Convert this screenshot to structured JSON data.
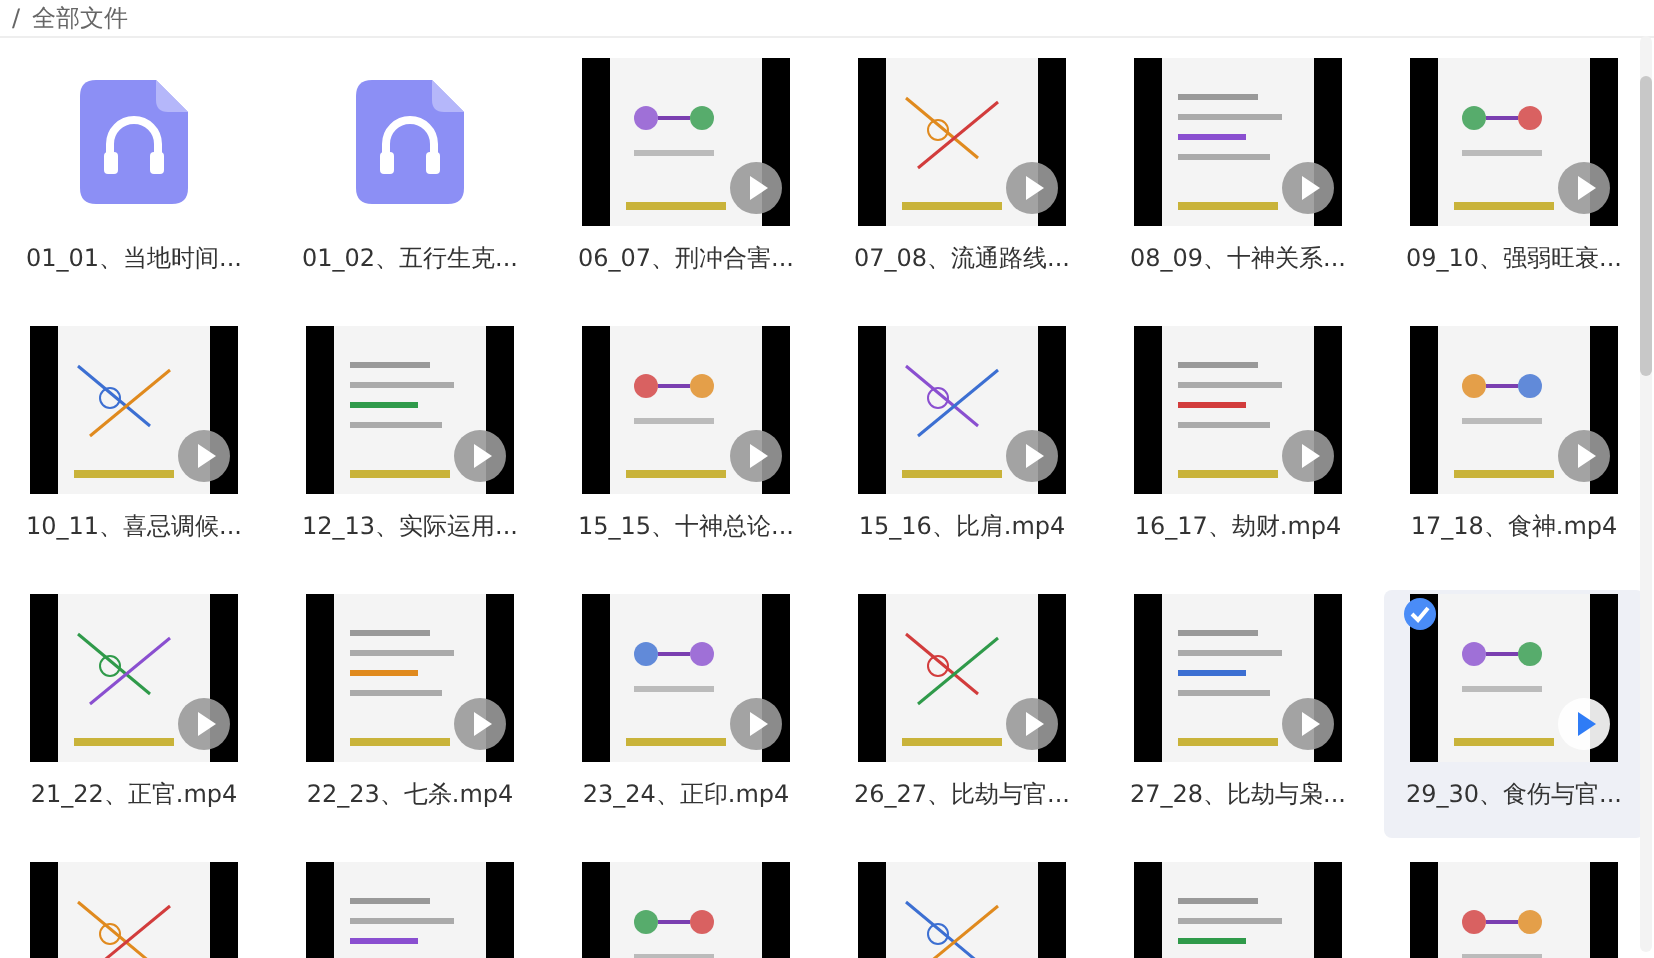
{
  "breadcrumb": {
    "separator": "/",
    "current": "全部文件"
  },
  "files": [
    {
      "kind": "audio",
      "name": "01_01、当地时间...",
      "selected": false
    },
    {
      "kind": "audio",
      "name": "01_02、五行生克...",
      "selected": false
    },
    {
      "kind": "video",
      "name": "06_07、刑冲合害...",
      "selected": false
    },
    {
      "kind": "video",
      "name": "07_08、流通路线...",
      "selected": false
    },
    {
      "kind": "video",
      "name": "08_09、十神关系...",
      "selected": false
    },
    {
      "kind": "video",
      "name": "09_10、强弱旺衰...",
      "selected": false
    },
    {
      "kind": "video",
      "name": "10_11、喜忌调候...",
      "selected": false
    },
    {
      "kind": "video",
      "name": "12_13、实际运用...",
      "selected": false
    },
    {
      "kind": "video",
      "name": "15_15、十神总论...",
      "selected": false
    },
    {
      "kind": "video",
      "name": "15_16、比肩.mp4",
      "selected": false
    },
    {
      "kind": "video",
      "name": "16_17、劫财.mp4",
      "selected": false
    },
    {
      "kind": "video",
      "name": "17_18、食神.mp4",
      "selected": false
    },
    {
      "kind": "video",
      "name": "21_22、正官.mp4",
      "selected": false
    },
    {
      "kind": "video",
      "name": "22_23、七杀.mp4",
      "selected": false
    },
    {
      "kind": "video",
      "name": "23_24、正印.mp4",
      "selected": false
    },
    {
      "kind": "video",
      "name": "26_27、比劫与官...",
      "selected": false
    },
    {
      "kind": "video",
      "name": "27_28、比劫与枭...",
      "selected": false
    },
    {
      "kind": "video",
      "name": "29_30、食伤与官...",
      "selected": true
    },
    {
      "kind": "video",
      "selected": false
    },
    {
      "kind": "video",
      "selected": false
    },
    {
      "kind": "video",
      "selected": false
    },
    {
      "kind": "video",
      "selected": false
    },
    {
      "kind": "video",
      "selected": false
    },
    {
      "kind": "video",
      "selected": false
    }
  ]
}
